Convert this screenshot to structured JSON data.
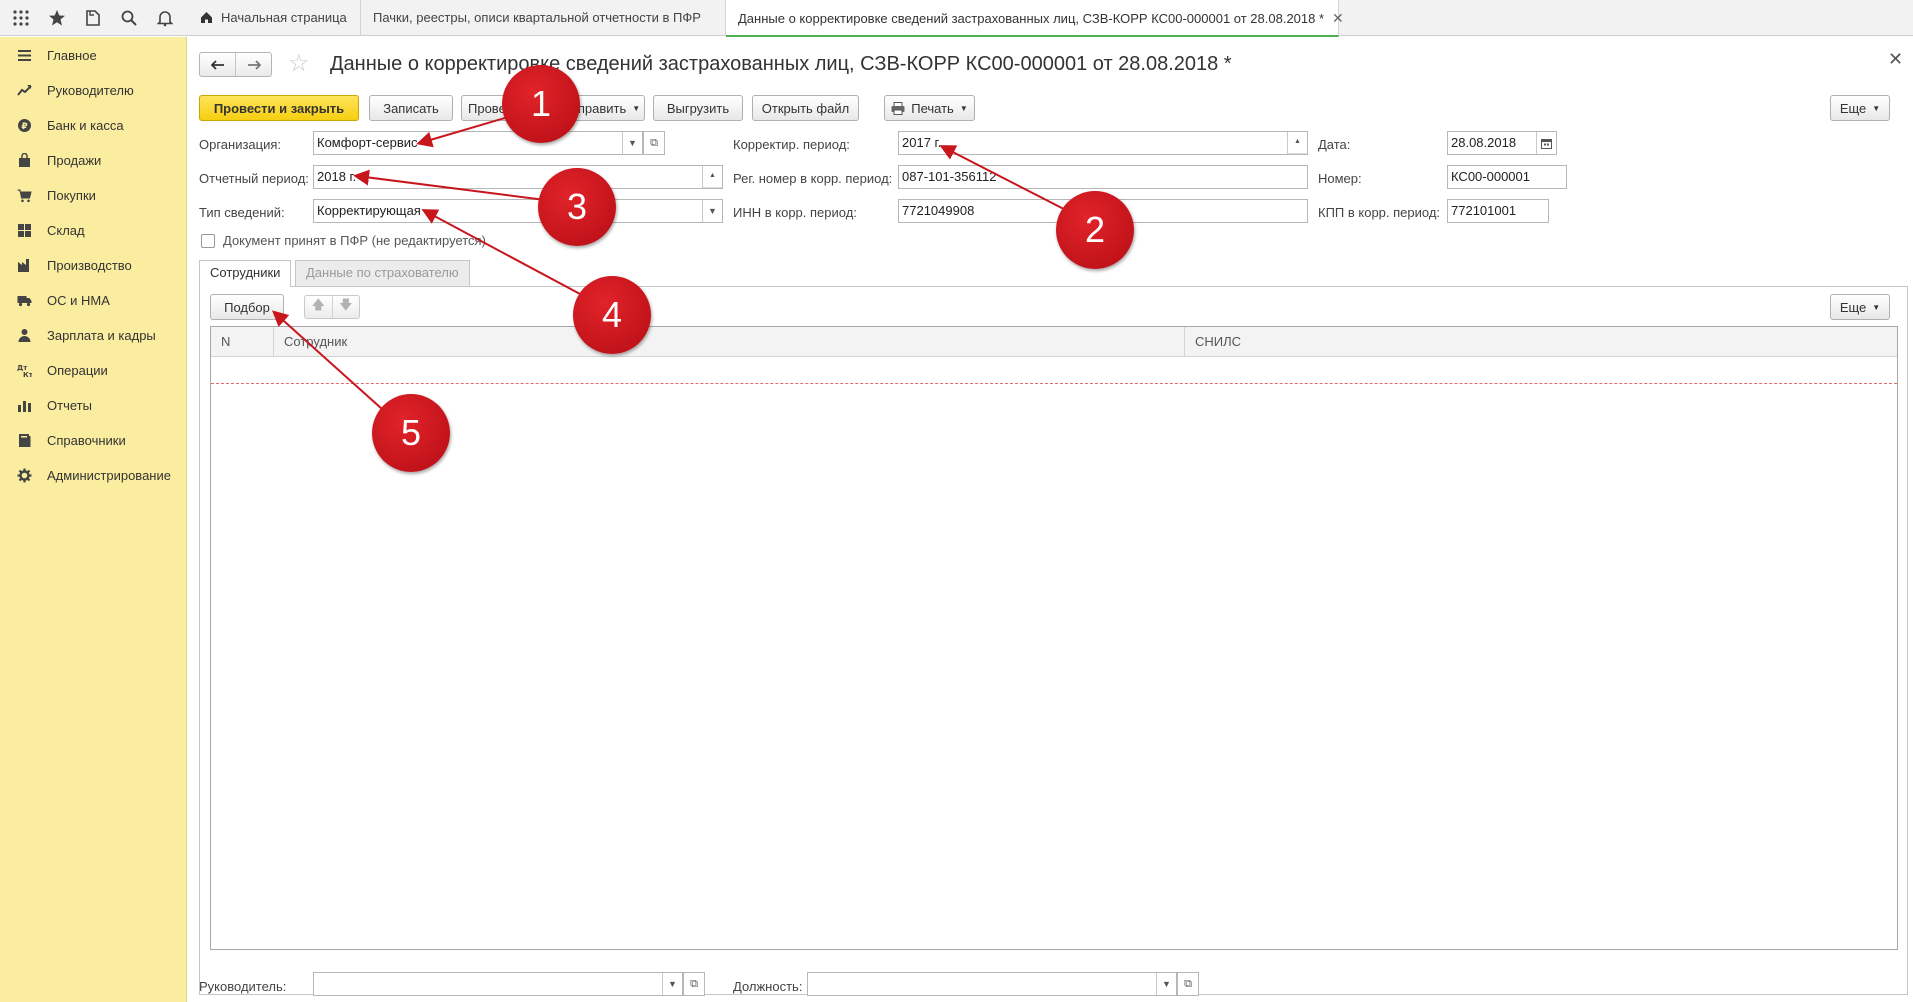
{
  "tabs": [
    {
      "label": "Начальная страница"
    },
    {
      "label": "Пачки, реестры, описи квартальной отчетности в ПФР"
    },
    {
      "label": "Данные о корректировке сведений застрахованных лиц, СЗВ-КОРР КС00-000001 от 28.08.2018 *"
    }
  ],
  "sidebar": {
    "items": [
      {
        "label": "Главное",
        "icon": "menu-icon"
      },
      {
        "label": "Руководителю",
        "icon": "trend-icon"
      },
      {
        "label": "Банк и касса",
        "icon": "ruble-icon"
      },
      {
        "label": "Продажи",
        "icon": "bag-icon"
      },
      {
        "label": "Покупки",
        "icon": "cart-icon"
      },
      {
        "label": "Склад",
        "icon": "warehouse-icon"
      },
      {
        "label": "Производство",
        "icon": "factory-icon"
      },
      {
        "label": "ОС и НМА",
        "icon": "truck-icon"
      },
      {
        "label": "Зарплата и кадры",
        "icon": "person-icon"
      },
      {
        "label": "Операции",
        "icon": "dtkt-icon"
      },
      {
        "label": "Отчеты",
        "icon": "bar-chart-icon"
      },
      {
        "label": "Справочники",
        "icon": "book-icon"
      },
      {
        "label": "Администрирование",
        "icon": "gear-icon"
      }
    ]
  },
  "document": {
    "title": "Данные о корректировке сведений застрахованных лиц, СЗВ-КОРР КС00-000001 от 28.08.2018 *",
    "toolbar": {
      "post_close": "Провести и закрыть",
      "save": "Записать",
      "check": "Прове",
      "send": "Отправить",
      "unload": "Выгрузить",
      "open_file": "Открыть файл",
      "print": "Печать",
      "more": "Еще"
    },
    "fields": {
      "org_label": "Организация:",
      "org_value": "Комфорт-сервис",
      "period_label": "Отчетный период:",
      "period_value": "2018 г.",
      "type_label": "Тип сведений:",
      "type_value": "Корректирующая",
      "corr_period_label": "Корректир. период:",
      "corr_period_value": "2017 г.",
      "reg_label": "Рег. номер в корр. период:",
      "reg_value": "087-101-356112",
      "inn_label": "ИНН в корр. период:",
      "inn_value": "7721049908",
      "date_label": "Дата:",
      "date_value": "28.08.2018",
      "number_label": "Номер:",
      "number_value": "КС00-000001",
      "kpp_label": "КПП в корр. период:",
      "kpp_value": "772101001",
      "accepted_label": "Документ принят в ПФР (не редактируется)",
      "accepted_checked": false
    },
    "subtabs": {
      "employees": "Сотрудники",
      "insurer": "Данные по страхователю"
    },
    "table": {
      "pick_button": "Подбор",
      "more": "Еще",
      "columns": [
        "N",
        "Сотрудник",
        "СНИЛС"
      ],
      "rows": []
    },
    "footer": {
      "manager_label": "Руководитель:",
      "manager_value": "",
      "position_label": "Должность:",
      "position_value": ""
    }
  },
  "annotations": [
    "1",
    "2",
    "3",
    "4",
    "5"
  ],
  "colors": {
    "sidebar_bg": "#fbeda0",
    "primary_button": "#f6cf10",
    "annotation_red": "#c8161d",
    "active_tab_underline": "#4caf50"
  }
}
